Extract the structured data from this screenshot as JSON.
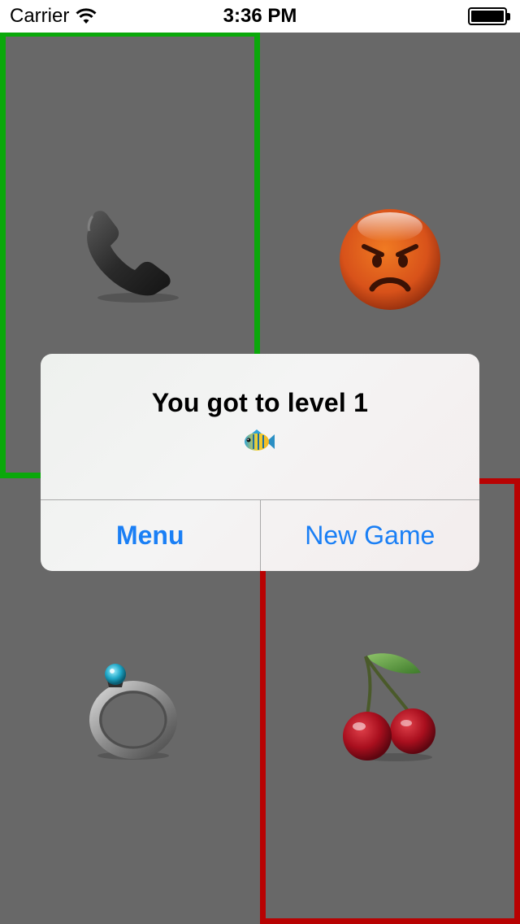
{
  "status_bar": {
    "carrier": "Carrier",
    "time": "3:36 PM",
    "wifi_icon": "wifi-icon",
    "battery_icon": "battery-icon",
    "battery_level": 1.0
  },
  "board": {
    "background": "#686868",
    "tiles": [
      {
        "position": "top-left",
        "icon": "telephone-receiver-icon",
        "highlight": "green"
      },
      {
        "position": "top-right",
        "icon": "angry-face-icon",
        "highlight": "none"
      },
      {
        "position": "bottom-left",
        "icon": "ring-icon",
        "highlight": "none"
      },
      {
        "position": "bottom-right",
        "icon": "cherries-icon",
        "highlight": "red"
      }
    ],
    "highlight_colors": {
      "green": "#0aa80a",
      "red": "#b80202"
    }
  },
  "alert": {
    "title": "You got to level 1",
    "icon": "tropical-fish-icon",
    "buttons": {
      "menu_label": "Menu",
      "new_game_label": "New Game"
    },
    "button_color": "#1a7ff5"
  }
}
